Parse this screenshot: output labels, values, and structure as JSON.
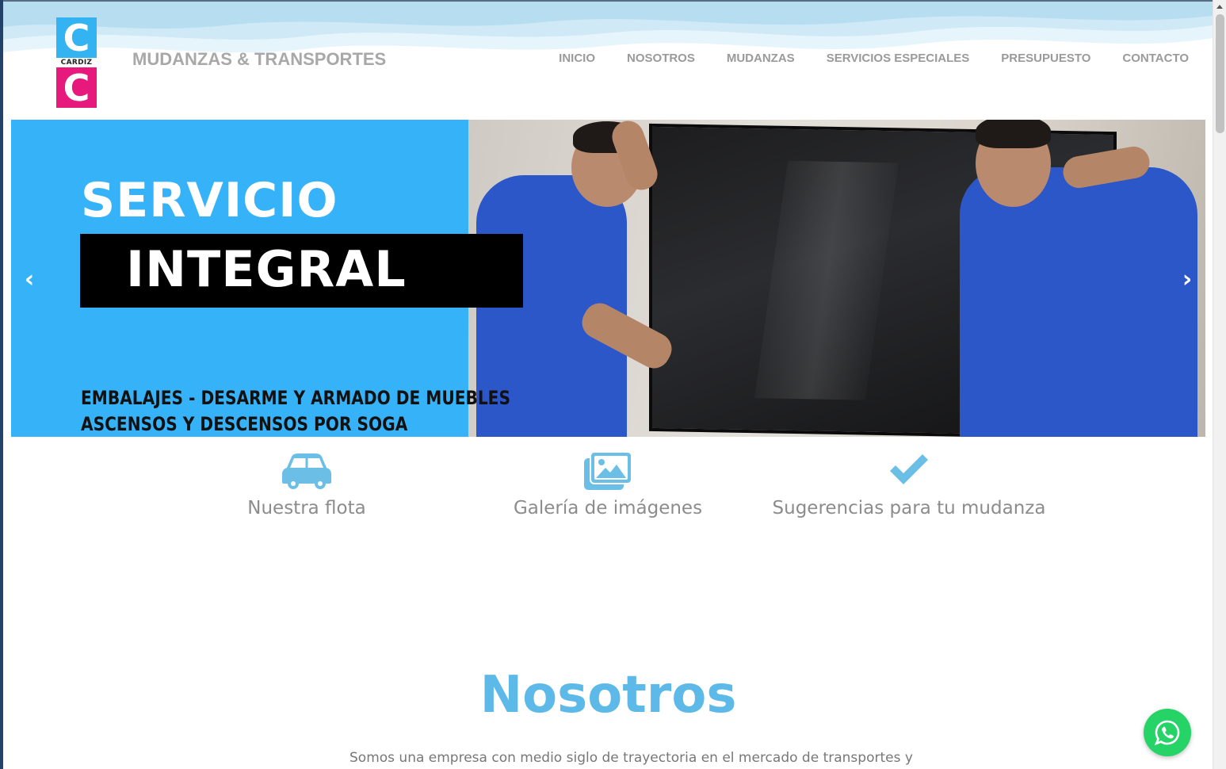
{
  "brand": {
    "logo_letter_top": "C",
    "logo_word": "CARDIZ",
    "logo_letter_bottom": "C",
    "title": "MUDANZAS & TRANSPORTES",
    "colors": {
      "logo_top": "#34b3f2",
      "logo_bottom": "#e8197d"
    }
  },
  "nav": {
    "items": [
      {
        "label": "INICIO"
      },
      {
        "label": "NOSOTROS"
      },
      {
        "label": "MUDANZAS"
      },
      {
        "label": "SERVICIOS ESPECIALES"
      },
      {
        "label": "PRESUPUESTO"
      },
      {
        "label": "CONTACTO"
      }
    ]
  },
  "carousel": {
    "heading_1": "SERVICIO",
    "heading_2": "INTEGRAL",
    "sub_1": "EMBALAJES - DESARME Y ARMADO DE MUEBLES",
    "sub_2": "ASCENSOS Y DESCENSOS POR SOGA",
    "prev_icon": "chevron-left-icon",
    "next_icon": "chevron-right-icon",
    "prev_glyph": "‹",
    "next_glyph": "›",
    "background_color": "#36b2f8"
  },
  "features": [
    {
      "icon": "car-icon",
      "label": "Nuestra flota"
    },
    {
      "icon": "images-icon",
      "label": "Galería de imágenes"
    },
    {
      "icon": "check-icon",
      "label": "Sugerencias para tu mudanza"
    }
  ],
  "about": {
    "title": "Nosotros",
    "text": "Somos una empresa con medio siglo de trayectoria en el mercado de transportes y"
  },
  "whatsapp": {
    "icon": "whatsapp-icon",
    "color": "#25d366"
  },
  "accent_color": "#5db9e8"
}
